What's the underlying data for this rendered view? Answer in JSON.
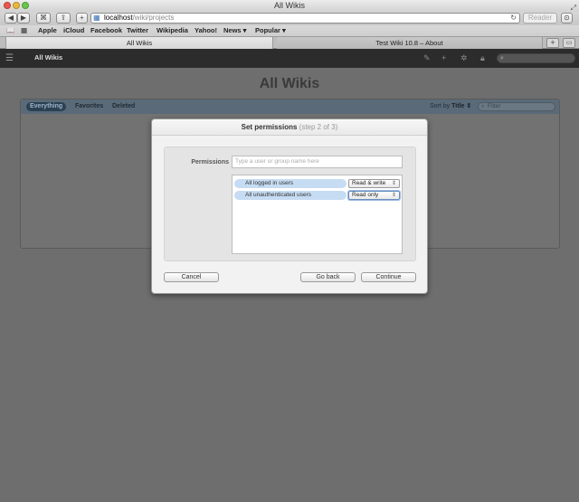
{
  "window": {
    "title": "All Wikis"
  },
  "toolbar": {
    "back": "◀",
    "forward": "▶",
    "url_host": "localhost",
    "url_path": "/wiki/projects",
    "reader_label": "Reader"
  },
  "bookmarks": [
    "Apple",
    "iCloud",
    "Facebook",
    "Twitter",
    "Wikipedia",
    "Yahoo!",
    "News ▾",
    "Popular ▾"
  ],
  "tabs": [
    {
      "label": "All Wikis"
    },
    {
      "label": "Test Wiki 10.8 – About"
    }
  ],
  "wiki_header": {
    "title": "All Wikis",
    "search_placeholder": ""
  },
  "page": {
    "heading": "All Wikis",
    "filters": [
      "Everything",
      "Favorites",
      "Deleted"
    ],
    "sort_label": "Sort by",
    "sort_value": "Title ⇕",
    "filter_placeholder": "Filter"
  },
  "dialog": {
    "title": "Set permissions",
    "step": "(step 2 of 3)",
    "permissions_label": "Permissions",
    "input_placeholder": "Type a user or group name here",
    "entries": [
      {
        "name": "All logged in users",
        "access": "Read & write"
      },
      {
        "name": "All unauthenticated users",
        "access": "Read only"
      }
    ],
    "cancel_label": "Cancel",
    "back_label": "Go back",
    "continue_label": "Continue"
  }
}
